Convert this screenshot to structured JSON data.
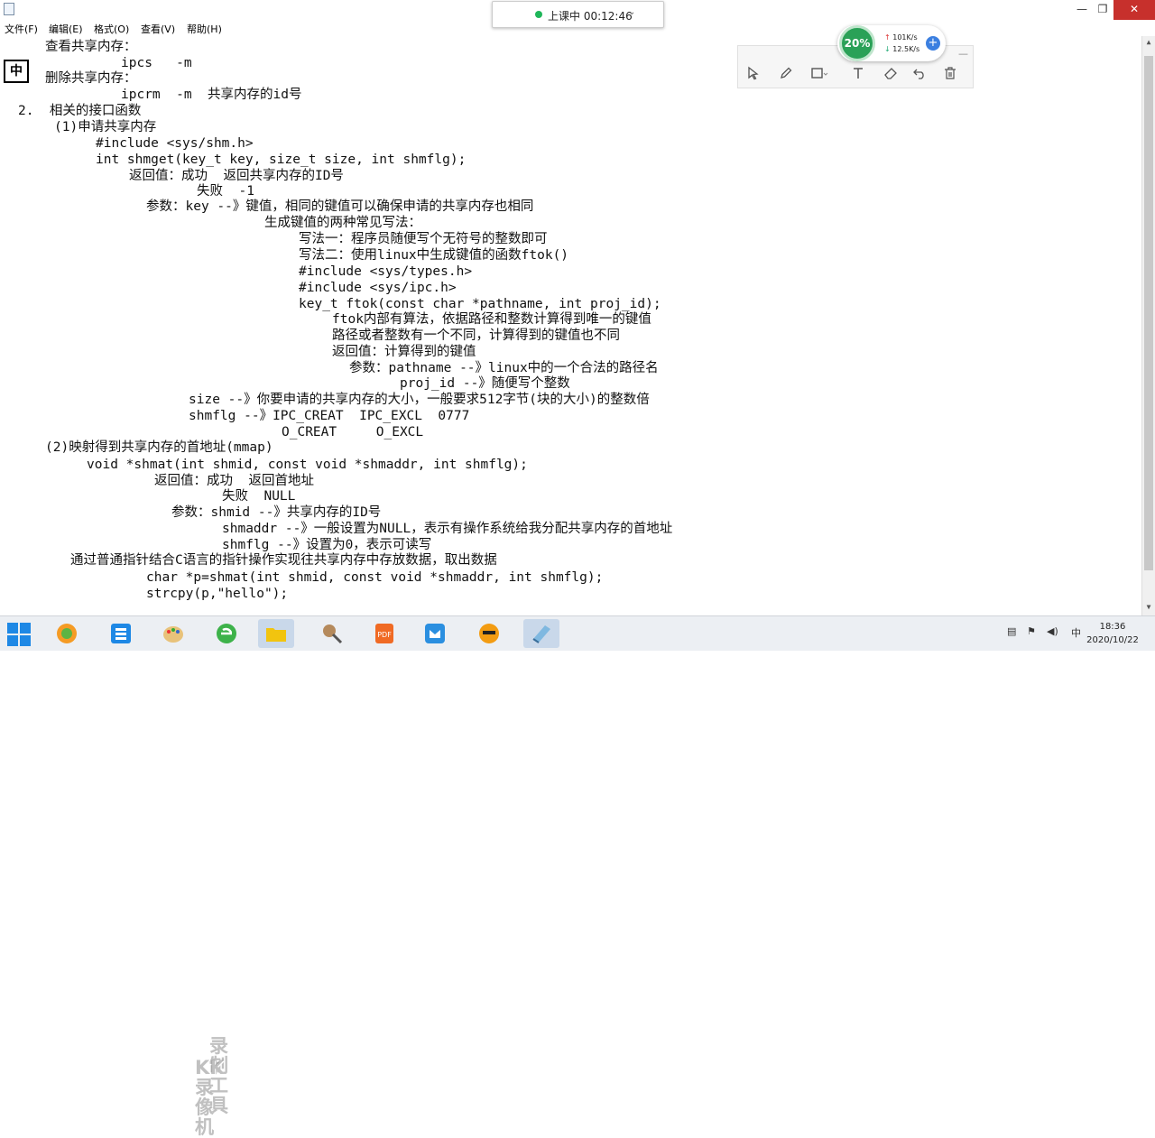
{
  "window": {
    "min_glyph": "—",
    "max_glyph": "❐",
    "close_glyph": "✕"
  },
  "menu": [
    "文件(F)",
    "编辑(E)",
    "格式(O)",
    "查看(V)",
    "帮助(H)"
  ],
  "ime_indicator": "中",
  "live": {
    "status": "上课中 00:12:46",
    "chevron": "⌄"
  },
  "network": {
    "percent": "20%",
    "upload": "101K/s",
    "download": "12.5K/s",
    "plus": "+"
  },
  "annotation_tools": {
    "select": "select-icon",
    "pen": "pen-icon",
    "shape": "rectangle-icon",
    "text": "text-icon",
    "eraser": "eraser-icon",
    "undo": "undo-icon",
    "delete": "trash-icon"
  },
  "document": {
    "lines": [
      "查看共享内存：",
      "ipcs   -m",
      "删除共享内存：",
      "ipcrm  -m  共享内存的id号",
      "2.  相关的接口函数",
      "(1)申请共享内存",
      "#include <sys/shm.h>",
      "int shmget(key_t key, size_t size, int shmflg);",
      "返回值：成功  返回共享内存的ID号",
      "失败  -1",
      "参数：key --》键值，相同的键值可以确保申请的共享内存也相同",
      "生成键值的两种常见写法：",
      "写法一：程序员随便写个无符号的整数即可",
      "写法二：使用linux中生成键值的函数ftok()",
      "#include <sys/types.h>",
      "#include <sys/ipc.h>",
      "key_t ftok(const char *pathname, int proj_id);",
      "ftok内部有算法，依据路径和整数计算得到唯一的键值",
      "路径或者整数有一个不同，计算得到的键值也不同",
      "返回值：计算得到的键值",
      "参数：pathname --》linux中的一个合法的路径名",
      "proj_id --》随便写个整数",
      "size --》你要申请的共享内存的大小，一般要求512字节(块的大小)的整数倍",
      "shmflg --》IPC_CREAT  IPC_EXCL  0777",
      "O_CREAT     O_EXCL",
      "(2)映射得到共享内存的首地址(mmap)",
      "void *shmat(int shmid, const void *shmaddr, int shmflg);",
      "返回值：成功  返回首地址",
      "失败  NULL",
      "参数：shmid --》共享内存的ID号",
      "shmaddr --》一般设置为NULL，表示有操作系统给我分配共享内存的首地址",
      "shmflg --》设置为0，表示可读写",
      "通过普通指针结合C语言的指针操作实现往共享内存中存放数据，取出数据",
      "char *p=shmat(int shmid, const void *shmaddr, int shmflg);",
      "strcpy(p,\"hello\");"
    ]
  },
  "watermark": [
    "录制工具",
    "KK录像机"
  ],
  "taskbar": {
    "apps": [
      "browser-icon",
      "file-manager-icon",
      "paint-icon",
      "ie-icon",
      "folder-icon",
      "tool-icon",
      "pdf-icon",
      "email-icon",
      "chat-icon",
      "notepad-icon"
    ],
    "tray_ime": "中",
    "time": "18:36",
    "date": "2020/10/22"
  }
}
